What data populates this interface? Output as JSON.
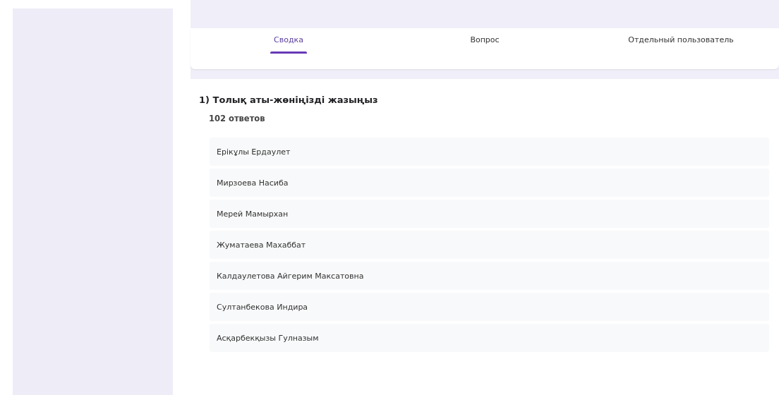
{
  "tabs": [
    {
      "label": "Сводка",
      "selected": true
    },
    {
      "label": "Вопрос",
      "selected": false
    },
    {
      "label": "Отдельный пользователь",
      "selected": false
    }
  ],
  "question": {
    "title": "1) Толық аты-жөніңізді жазыңыз",
    "count": "102 ответов",
    "answers": [
      "Ерікұлы Ердаулет",
      "Мирзоева Насиба",
      "Мерей Мамырхан",
      "Жуматаева Махаббат",
      "Калдаулетова Айгерим Максатовна",
      "Султанбекова Индира",
      "Асқарбекқызы Гулназым"
    ]
  }
}
